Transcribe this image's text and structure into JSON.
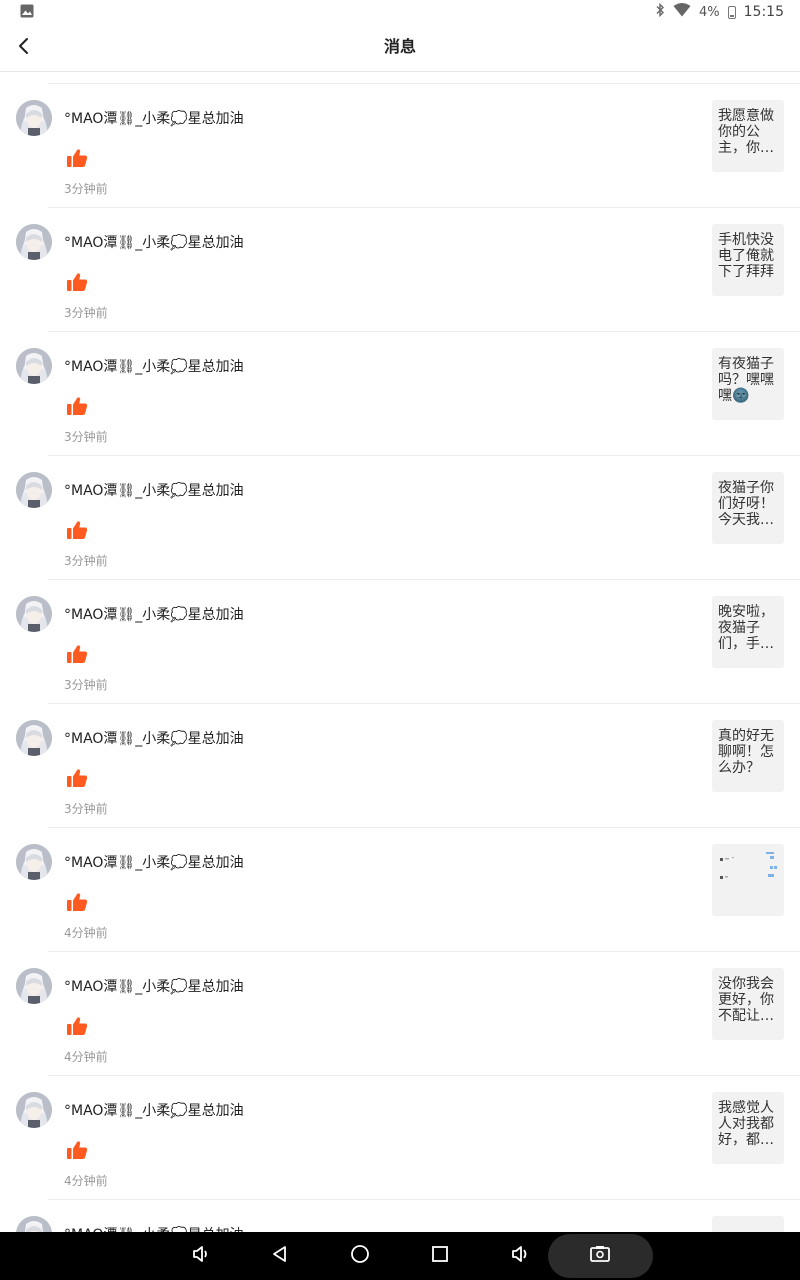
{
  "status_bar": {
    "battery_percent": "4%",
    "time": "15:15",
    "icons": [
      "gallery-icon",
      "bluetooth-icon",
      "wifi-icon",
      "battery-icon"
    ]
  },
  "header": {
    "title": "消息",
    "back_icon": "chevron-left-icon"
  },
  "messages": [
    {
      "username": "°MAO潭⛓_小柔💭星总加油",
      "time": "3分钟前",
      "preview": "我愿意做你的公主，你…",
      "preview_type": "text"
    },
    {
      "username": "°MAO潭⛓_小柔💭星总加油",
      "time": "3分钟前",
      "preview": "手机快没电了俺就下了拜拜",
      "preview_type": "text"
    },
    {
      "username": "°MAO潭⛓_小柔💭星总加油",
      "time": "3分钟前",
      "preview": "有夜猫子吗？嘿嘿嘿🌚",
      "preview_type": "text"
    },
    {
      "username": "°MAO潭⛓_小柔💭星总加油",
      "time": "3分钟前",
      "preview": "夜猫子你们好呀！今天我…",
      "preview_type": "text"
    },
    {
      "username": "°MAO潭⛓_小柔💭星总加油",
      "time": "3分钟前",
      "preview": "晚安啦，夜猫子们，手…",
      "preview_type": "text"
    },
    {
      "username": "°MAO潭⛓_小柔💭星总加油",
      "time": "3分钟前",
      "preview": "真的好无聊啊！怎么办？",
      "preview_type": "text"
    },
    {
      "username": "°MAO潭⛓_小柔💭星总加油",
      "time": "4分钟前",
      "preview": "",
      "preview_type": "image"
    },
    {
      "username": "°MAO潭⛓_小柔💭星总加油",
      "time": "4分钟前",
      "preview": "没你我会更好，你不配让…",
      "preview_type": "text"
    },
    {
      "username": "°MAO潭⛓_小柔💭星总加油",
      "time": "4分钟前",
      "preview": "我感觉人人对我都好，都…",
      "preview_type": "text"
    },
    {
      "username": "°MAO潭⛓_小柔💭星总加油",
      "time": "",
      "preview": "",
      "preview_type": "text"
    }
  ],
  "like_icon": "thumbs-up-icon",
  "like_color": "#ff5a1f",
  "system_nav": {
    "buttons": [
      "volume-down-icon",
      "back-triangle-icon",
      "home-circle-icon",
      "recents-square-icon",
      "volume-up-icon",
      "screenshot-icon"
    ]
  }
}
